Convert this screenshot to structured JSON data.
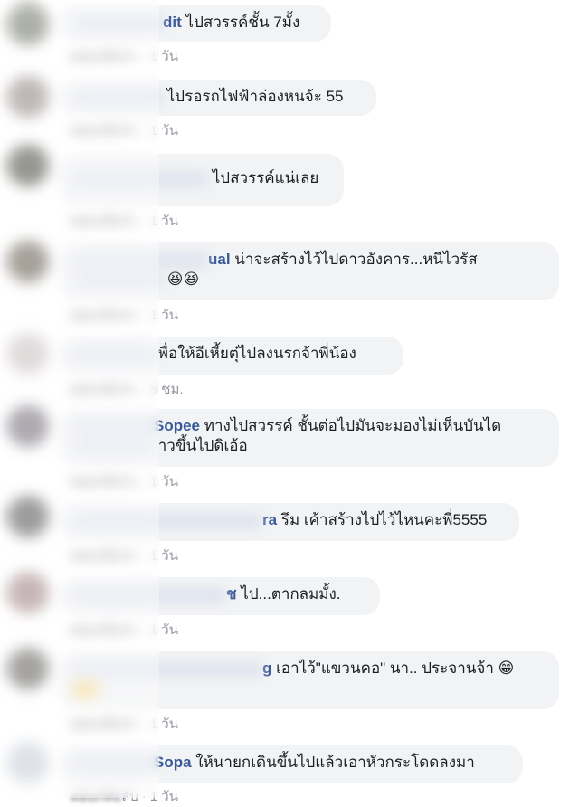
{
  "comments": [
    {
      "name_visible": "dit",
      "text": "ไปสวรรค์ชั้น 7มั้ง",
      "meta_action": "ลับ",
      "meta_time": "1 วัน"
    },
    {
      "name_visible": "",
      "text": "ไปรอรถไฟฟ้าล่องหนจ้ะ 55",
      "meta_action": "ลับ",
      "meta_time": "1 วัน"
    },
    {
      "name_visible": "",
      "text": "ไปสวรรค์แน่เลย",
      "meta_action": "ลับ",
      "meta_time": "1 วัน"
    },
    {
      "name_visible": "ual",
      "text": "น่าจะสร้างไว้ไปดาวอังคาร...หนีไวรัส",
      "text2": "😆😆",
      "meta_action": "ลับ",
      "meta_time": "1 วัน"
    },
    {
      "name_visible": "",
      "text": "พื่อให้อีเหี้ยตุ๋ไปลงนรกจ้าพี่น้อง",
      "meta_action": "ลับ",
      "meta_time": "5 ชม."
    },
    {
      "name_visible": "Sopee",
      "text": "ทางไปสวรรค์ ชั้นต่อไปมันจะมองไม่เห็นบันได",
      "text2": "าวขึ้นไปดิเอ้อ",
      "meta_action": "ลับ",
      "meta_time": "1 วัน"
    },
    {
      "name_visible": "ra",
      "text": "รึม เค้าสร้างไปไว้ไหนคะพี่5555",
      "meta_action": "ลับ",
      "meta_time": "1 วัน"
    },
    {
      "name_visible": "ช",
      "text": "ไป...ตากลมมั้ง.",
      "meta_action": "ลับ",
      "meta_time": "1 วัน"
    },
    {
      "name_visible": "g",
      "text": "เอาไว้\"แขวนคอ\" นา.. ประจานจ้า 😁",
      "meta_action": "ลับ",
      "meta_time": "1 วัน"
    },
    {
      "name_visible": "Sopa",
      "text": "ให้นายกเดินขึ้นไปแล้วเอาหัวกระโดดลงมา",
      "meta_action": "ลับ",
      "meta_time": "1 วัน"
    }
  ],
  "meta_separator": "·",
  "colors": {
    "name": "#385898",
    "bubble": "#f2f3f5",
    "meta": "#90949c"
  }
}
